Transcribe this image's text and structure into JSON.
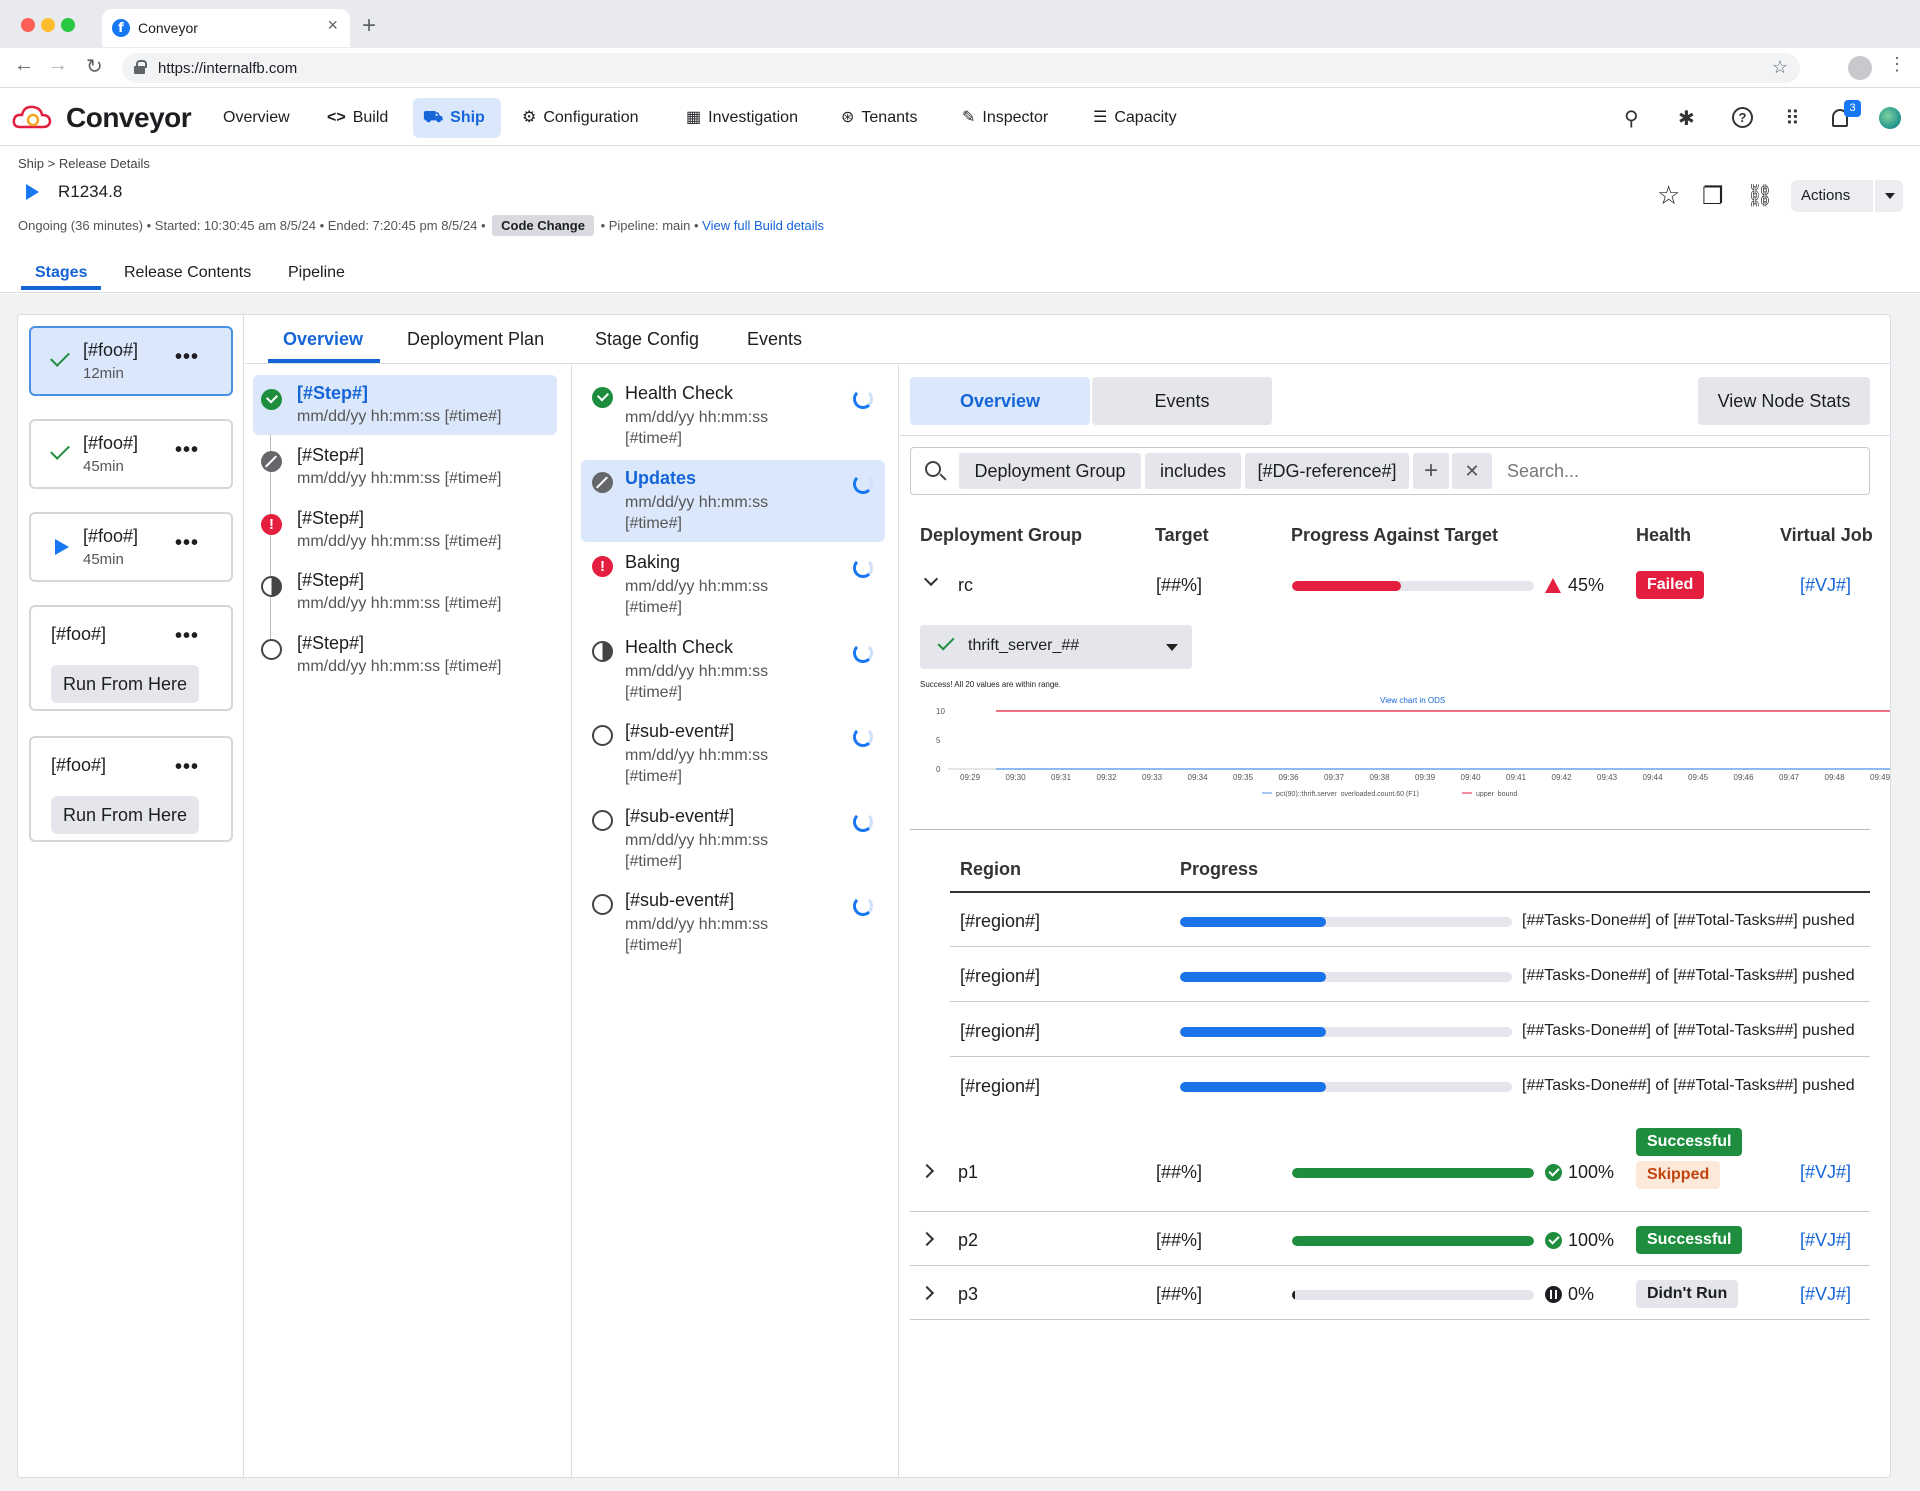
{
  "browser": {
    "tab_title": "Conveyor",
    "url": "https://internalfb.com",
    "close_glyph": "×",
    "new_tab_glyph": "+",
    "back_glyph": "←",
    "forward_glyph": "→",
    "reload_glyph": "↻",
    "star_glyph": "☆",
    "menu_glyph": "⋮",
    "fav_letter": "f"
  },
  "app": {
    "brand": "Conveyor",
    "nav": [
      {
        "label": "Overview",
        "icon": ""
      },
      {
        "label": "Build",
        "icon": "<>"
      },
      {
        "label": "Ship",
        "icon": "⛟"
      },
      {
        "label": "Configuration",
        "icon": "⚙"
      },
      {
        "label": "Investigation",
        "icon": "▦"
      },
      {
        "label": "Tenants",
        "icon": "⊛"
      },
      {
        "label": "Inspector",
        "icon": "✎"
      },
      {
        "label": "Capacity",
        "icon": "☰"
      }
    ],
    "right_icons": {
      "share": "⚲",
      "bug": "✱",
      "help": "?",
      "apps": "⠿",
      "bell": "♫"
    },
    "notification_count": "3"
  },
  "header": {
    "breadcrumb": "Ship > Release Details",
    "release": "R1234.8",
    "meta_prefix": "Ongoing (36 minutes) • Started: 10:30:45 am 8/5/24 • Ended: 7:20:45 pm 8/5/24 •",
    "code_change": "Code Change",
    "meta_suffix": "• Pipeline: main •",
    "build_link": "View full Build details",
    "actions": "Actions",
    "icons": {
      "star": "☆",
      "copy": "❐",
      "link": "⛓"
    }
  },
  "page_tabs": [
    "Stages",
    "Release Contents",
    "Pipeline"
  ],
  "stages": [
    {
      "name": "[#foo#]",
      "duration": "12min",
      "status": "success"
    },
    {
      "name": "[#foo#]",
      "duration": "45min",
      "status": "success"
    },
    {
      "name": "[#foo#]",
      "duration": "45min",
      "status": "running"
    },
    {
      "name": "[#foo#]",
      "action": "Run From Here"
    },
    {
      "name": "[#foo#]",
      "action": "Run From Here"
    }
  ],
  "more_glyph": "•••",
  "inner_tabs": [
    "Overview",
    "Deployment Plan",
    "Stage Config",
    "Events"
  ],
  "steps": [
    {
      "title": "[#Step#]",
      "sub": "mm/dd/yy hh:mm:ss [#time#]",
      "status": "ok"
    },
    {
      "title": "[#Step#]",
      "sub": "mm/dd/yy hh:mm:ss [#time#]",
      "status": "skip"
    },
    {
      "title": "[#Step#]",
      "sub": "mm/dd/yy hh:mm:ss [#time#]",
      "status": "err"
    },
    {
      "title": "[#Step#]",
      "sub": "mm/dd/yy hh:mm:ss [#time#]",
      "status": "half"
    },
    {
      "title": "[#Step#]",
      "sub": "mm/dd/yy hh:mm:ss [#time#]",
      "status": "empty"
    }
  ],
  "err_glyph": "!",
  "events": [
    {
      "title": "Health Check",
      "sub": "mm/dd/yy hh:mm:ss [#time#]",
      "status": "ok"
    },
    {
      "title": "Updates",
      "sub": "mm/dd/yy hh:mm:ss [#time#]",
      "status": "skip"
    },
    {
      "title": "Baking",
      "sub": "mm/dd/yy hh:mm:ss [#time#]",
      "status": "err"
    },
    {
      "title": "Health Check",
      "sub": "mm/dd/yy hh:mm:ss [#time#]",
      "status": "half"
    },
    {
      "title": "[#sub-event#]",
      "sub": "mm/dd/yy hh:mm:ss [#time#]",
      "status": "empty"
    },
    {
      "title": "[#sub-event#]",
      "sub": "mm/dd/yy hh:mm:ss [#time#]",
      "status": "empty"
    },
    {
      "title": "[#sub-event#]",
      "sub": "mm/dd/yy hh:mm:ss [#time#]",
      "status": "empty"
    }
  ],
  "detail": {
    "segments": [
      "Overview",
      "Events"
    ],
    "view_node_stats": "View Node Stats",
    "filter": {
      "chips": [
        "Deployment Group",
        "includes",
        "[#DG-reference#]"
      ],
      "plus": "+",
      "clear": "✕",
      "placeholder": "Search..."
    },
    "columns": [
      "Deployment Group",
      "Target",
      "Progress Against Target",
      "Health",
      "Virtual Job"
    ],
    "groups": [
      {
        "name": "rc",
        "target": "[##%]",
        "progress": 45,
        "pct_label": "45%",
        "health": [
          "Failed"
        ],
        "vj": "[#VJ#]",
        "expanded": true
      },
      {
        "name": "p1",
        "target": "[##%]",
        "progress": 100,
        "pct_label": "100%",
        "health": [
          "Successful",
          "Skipped"
        ],
        "vj": "[#VJ#]"
      },
      {
        "name": "p2",
        "target": "[##%]",
        "progress": 100,
        "pct_label": "100%",
        "health": [
          "Successful"
        ],
        "vj": "[#VJ#]"
      },
      {
        "name": "p3",
        "target": "[##%]",
        "progress": 0,
        "pct_label": "0%",
        "health": [
          "Didn't Run"
        ],
        "vj": "[#VJ#]"
      }
    ],
    "selector": "thrift_server_##",
    "region_columns": [
      "Region",
      "Progress"
    ],
    "regions": [
      {
        "name": "[#region#]",
        "progress": 0.44,
        "text": "[##Tasks-Done##] of [##Total-Tasks##] pushed"
      },
      {
        "name": "[#region#]",
        "progress": 0.44,
        "text": "[##Tasks-Done##] of [##Total-Tasks##] pushed"
      },
      {
        "name": "[#region#]",
        "progress": 0.44,
        "text": "[##Tasks-Done##] of [##Total-Tasks##] pushed"
      },
      {
        "name": "[#region#]",
        "progress": 0.44,
        "text": "[##Tasks-Done##] of [##Total-Tasks##] pushed"
      }
    ]
  },
  "chart_data": {
    "type": "line",
    "title": "Success! All 20 values are within range.",
    "link": "View chart in ODS",
    "x": [
      "09:29",
      "09:30",
      "09:31",
      "09:32",
      "09:33",
      "09:34",
      "09:35",
      "09:36",
      "09:37",
      "09:38",
      "09:39",
      "09:40",
      "09:41",
      "09:42",
      "09:43",
      "09:44",
      "09:45",
      "09:46",
      "09:47",
      "09:48",
      "09:49"
    ],
    "yticks": [
      "10",
      "5",
      "0"
    ],
    "ylim": [
      0,
      10
    ],
    "series": [
      {
        "name": "pct(90)::thrift.server_overloaded.count.60 (F1)",
        "color": "#4a90e2",
        "value": 0
      },
      {
        "name": "upper_bound",
        "color": "#e41e3f",
        "value": 10
      }
    ],
    "legend": "bottom"
  },
  "colors": {
    "accent": "#1565d8",
    "success": "#1e8e3e",
    "fail": "#e41e3f",
    "progress_blue": "#1a73e8"
  }
}
